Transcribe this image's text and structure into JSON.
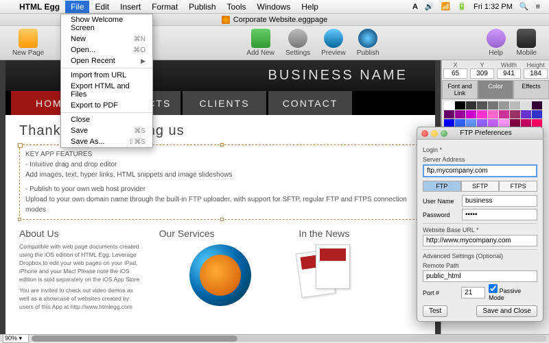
{
  "menubar": {
    "app": "HTML Egg",
    "items": [
      "File",
      "Edit",
      "Insert",
      "Format",
      "Publish",
      "Tools",
      "Windows",
      "Help"
    ],
    "clock": "Fri 1:32 PM"
  },
  "file_menu": {
    "welcome": "Show Welcome Screen",
    "new": "New",
    "new_sc": "⌘N",
    "open": "Open...",
    "open_sc": "⌘O",
    "recent": "Open Recent",
    "import": "Import from URL",
    "export_html": "Export HTML and Files",
    "export_pdf": "Export to PDF",
    "close": "Close",
    "save": "Save",
    "save_sc": "⌘S",
    "saveas": "Save As...",
    "saveas_sc": "⇧⌘S"
  },
  "doc_title": "Corporate Website.eggpage",
  "toolbar": {
    "newpage": "New Page",
    "addnew": "Add New",
    "settings": "Settings",
    "preview": "Preview",
    "publish": "Publish",
    "help": "Help",
    "mobile": "Mobile"
  },
  "page": {
    "business_name": "BUSINESS NAME",
    "nav": {
      "home": "HOME",
      "products": "PRODUCTS",
      "clients": "CLIENTS",
      "contact": "CONTACT"
    },
    "heading": "Thank you for visiting us",
    "features_title": "KEY APP FEATURES",
    "feat1": "- Intuitive drag and drop editor",
    "feat2": "Add images, text, hyper links, HTML snippets and image slideshows",
    "feat3": "- Publish to your own web host provider",
    "feat4": "Upload to your own domain name through the built-in FTP uploader, with support for SFTP, regular FTP and FTPS connection modes",
    "about_h": "About Us",
    "about_p1": "Compatible with web page documents created using the iOS edition of HTML Egg. Leverage Dropbox to edit your web pages on your iPad, iPhone and your Mac! Please note the iOS edition is sold separately on the iOS App Store",
    "about_p2": "You are invited to check out video demos as well as a showcase of websites created by users of this App at http://www.htmlegg.com",
    "services_h": "Our Services",
    "news_h": "In the News"
  },
  "inspector": {
    "x_lbl": "X",
    "y_lbl": "Y",
    "w_lbl": "Width",
    "h_lbl": "Height",
    "x": "65",
    "y": "309",
    "w": "941",
    "h": "184",
    "tab_font": "Font and Link",
    "tab_color": "Color",
    "tab_effects": "Effects",
    "colors": [
      "#ffffff",
      "#000000",
      "#333333",
      "#555555",
      "#777777",
      "#999999",
      "#bbbbbb",
      "#dddddd",
      "#330033",
      "#660066",
      "#990099",
      "#cc00cc",
      "#ff33cc",
      "#ff66cc",
      "#cc3399",
      "#993366",
      "#6633cc",
      "#3333cc",
      "#0000ff",
      "#3366ff",
      "#6699ff",
      "#9966ff",
      "#cc66ff",
      "#ff99ff",
      "#880044",
      "#cc0066",
      "#ff0066",
      "#ff3399",
      "#ff66aa",
      "#4b0082",
      "#8a2be2",
      "#9932cc"
    ]
  },
  "ftp": {
    "title": "FTP Preferences",
    "login": "Login *",
    "server_lbl": "Server Address",
    "server": "ftp.mycompany.com",
    "proto_ftp": "FTP",
    "proto_sftp": "SFTP",
    "proto_ftps": "FTPS",
    "user_lbl": "User Name",
    "user": "business",
    "pass_lbl": "Password",
    "pass": "•••••",
    "base_lbl": "Website Base URL *",
    "base": "http://www.mycompany.com",
    "adv": "Advanced Settings (Optional)",
    "remote_lbl": "Remote Path",
    "remote": "public_html",
    "port_lbl": "Port #",
    "port": "21",
    "passive": "Passive Mode",
    "test": "Test",
    "save": "Save and Close"
  },
  "status": {
    "zoom": "90%"
  }
}
